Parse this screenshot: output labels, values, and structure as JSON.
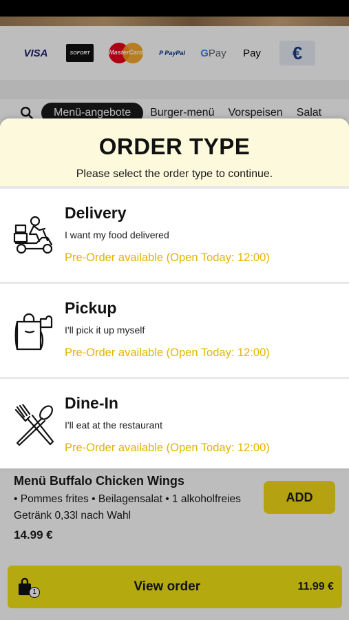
{
  "payments": {
    "visa": "VISA",
    "sofort": "SOFORT",
    "mastercard": "MasterCard",
    "paypal": "P PayPal",
    "gpay_g": "G",
    "gpay_pay": "Pay",
    "applepay": " Pay",
    "euro": "€"
  },
  "categories": {
    "active": "Menü-angebote",
    "items": [
      "Burger-menü",
      "Vorspeisen",
      "Salat"
    ]
  },
  "modal": {
    "title": "ORDER TYPE",
    "subtitle": "Please select the order type to continue.",
    "options": [
      {
        "title": "Delivery",
        "desc": "I want my food delivered",
        "status": "Pre-Order available (Open Today: 12:00)",
        "icon": "delivery-scooter-icon"
      },
      {
        "title": "Pickup",
        "desc": "I'll pick it up myself",
        "status": "Pre-Order available (Open Today: 12:00)",
        "icon": "pickup-bag-icon"
      },
      {
        "title": "Dine-In",
        "desc": "I'll eat at the restaurant",
        "status": "Pre-Order available (Open Today: 12:00)",
        "icon": "fork-spoon-icon"
      }
    ]
  },
  "menu_item": {
    "title": "Menü Buffalo Chicken Wings",
    "desc": "• Pommes frites • Beilagensalat • 1 alkoholfreies Getränk 0,33l nach Wahl",
    "price": "14.99 €",
    "add_label": "ADD"
  },
  "cart": {
    "count": "1",
    "label": "View order",
    "total": "11.99 €"
  },
  "colors": {
    "accent_yellow": "#f4e516",
    "status_gold": "#e2b300",
    "modal_header_bg": "#fcf9dc"
  }
}
